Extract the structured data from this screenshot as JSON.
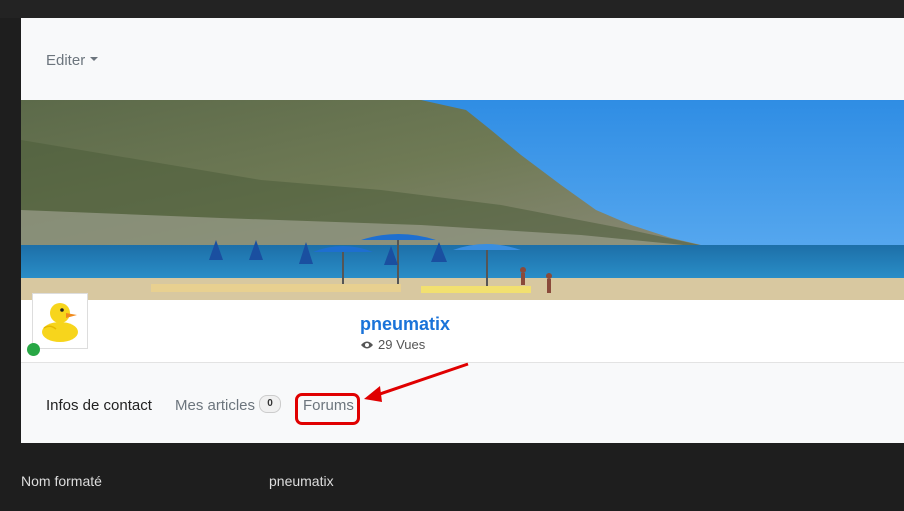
{
  "edit_menu": {
    "label": "Editer"
  },
  "profile": {
    "username": "pneumatix",
    "views": "29 Vues",
    "status": "online"
  },
  "tabs": [
    {
      "label": "Infos de contact",
      "active": true
    },
    {
      "label": "Mes articles",
      "badge": "0"
    },
    {
      "label": "Forums",
      "highlighted": true
    }
  ],
  "fields": [
    {
      "label": "Nom formaté",
      "value": "pneumatix"
    }
  ],
  "colors": {
    "accent": "#1a73d9",
    "online": "#28a745",
    "highlight": "#e00000"
  }
}
